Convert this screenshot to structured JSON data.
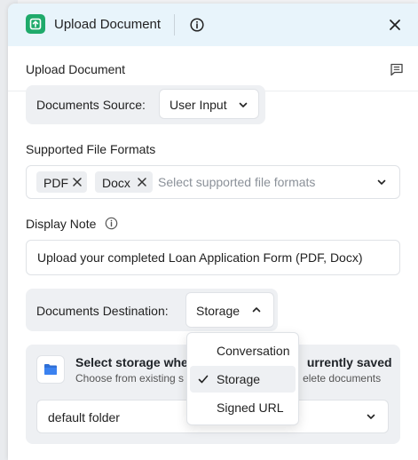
{
  "header": {
    "title": "Upload Document",
    "app_icon": "upload-document-icon",
    "accent_color": "#1faa6b"
  },
  "subheader": {
    "title": "Upload Document"
  },
  "source": {
    "label": "Documents Source:",
    "value": "User Input"
  },
  "formats": {
    "label": "Supported File Formats",
    "chips": [
      "PDF",
      "Docx"
    ],
    "placeholder": "Select supported file formats"
  },
  "note": {
    "label": "Display Note",
    "value": "Upload your completed Loan Application Form (PDF, Docx)"
  },
  "destination": {
    "label": "Documents Destination:",
    "value": "Storage",
    "options": [
      "Conversation",
      "Storage",
      "Signed URL"
    ],
    "selected_option": "Storage"
  },
  "storage": {
    "title_left": "Select storage whe",
    "title_right": "urrently saved",
    "subtitle_left": "Choose from existing s",
    "subtitle_right": "elete documents",
    "folder": "default folder"
  }
}
